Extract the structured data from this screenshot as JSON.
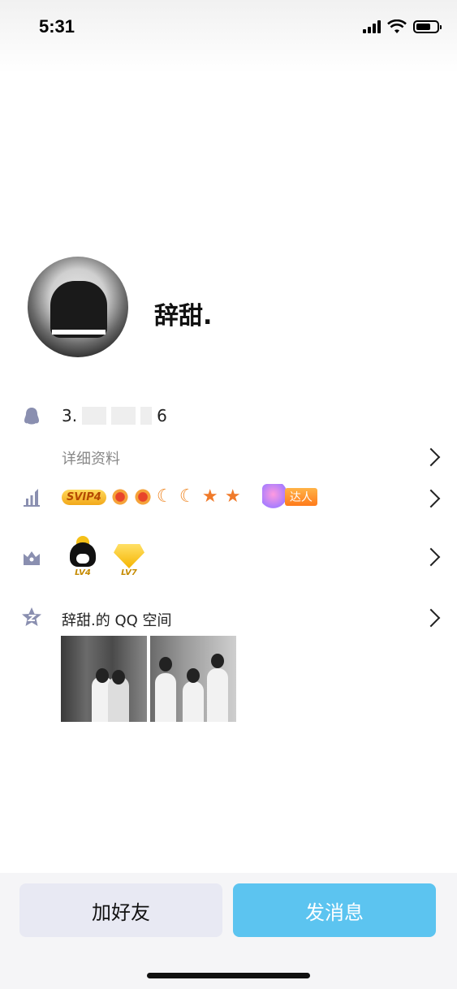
{
  "status_bar": {
    "time": "5:31",
    "icons": [
      "signal-icon",
      "wifi-icon",
      "battery-icon"
    ]
  },
  "profile": {
    "nickname": "辞甜.",
    "uin_prefix": "3.",
    "uin_suffix": "6"
  },
  "rows": {
    "details_label": "详细资料",
    "svip_badge": "SVIP4",
    "level_badges": [
      "sun",
      "sun",
      "moon",
      "moon",
      "star",
      "star"
    ],
    "daren_label": "达人",
    "penguin_level": "LV4",
    "diamond_level": "LV7",
    "qzone_title": "辞甜.的 QQ 空间"
  },
  "colors": {
    "accent": "#5cc4f0",
    "secondary_button": "#e8e9f3",
    "row_icon": "#8a8fb0"
  },
  "actions": {
    "add_friend": "加好友",
    "send_message": "发消息"
  }
}
